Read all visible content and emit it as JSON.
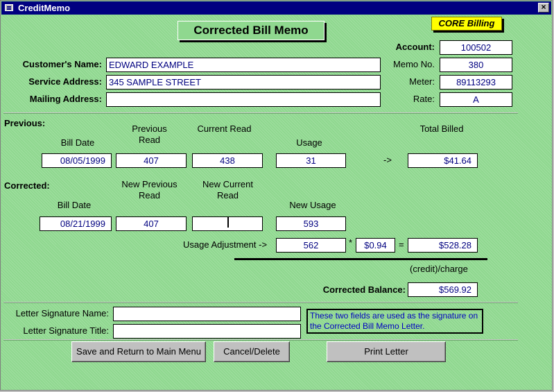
{
  "window": {
    "title": "CreditMemo",
    "close_glyph": "×"
  },
  "header": {
    "memo_title": "Corrected Bill Memo",
    "badge": "CORE Billing"
  },
  "account_info": {
    "account_label": "Account:",
    "account_value": "100502",
    "memo_no_label": "Memo No.",
    "memo_no_value": "380",
    "meter_label": "Meter:",
    "meter_value": "89113293",
    "rate_label": "Rate:",
    "rate_value": "A"
  },
  "customer": {
    "name_label": "Customer's Name:",
    "name_value": "EDWARD EXAMPLE",
    "service_label": "Service Address:",
    "service_value": "345 SAMPLE STREET",
    "mailing_label": "Mailing Address:",
    "mailing_value": ""
  },
  "previous": {
    "section_label": "Previous:",
    "bill_date_label": "Bill Date",
    "prev_read_label": "Previous Read",
    "curr_read_label": "Current Read",
    "usage_label": "Usage",
    "total_label": "Total Billed",
    "arrow": "->",
    "bill_date": "08/05/1999",
    "prev_read": "407",
    "curr_read": "438",
    "usage": "31",
    "total": "$41.64"
  },
  "corrected": {
    "section_label": "Corrected:",
    "bill_date_label": "Bill Date",
    "new_prev_label": "New Previous Read",
    "new_curr_label": "New Current Read",
    "new_usage_label": "New Usage",
    "bill_date": "08/21/1999",
    "new_prev": "407",
    "new_curr": "",
    "new_usage": "593"
  },
  "adjustment": {
    "label": "Usage Adjustment ->",
    "usage": "562",
    "times": "*",
    "rate": "$0.94",
    "equals": "=",
    "amount": "$528.28",
    "credit_charge": "(credit)/charge",
    "balance_label": "Corrected Balance:",
    "balance": "$569.92"
  },
  "signature": {
    "name_label": "Letter Signature Name:",
    "name_value": "",
    "title_label": "Letter Signature Title:",
    "title_value": "",
    "note": "These two fields are used as the signature on the Corrected Bill Memo Letter."
  },
  "buttons": {
    "save": "Save and Return to Main Menu",
    "cancel": "Cancel/Delete",
    "print": "Print Letter"
  }
}
